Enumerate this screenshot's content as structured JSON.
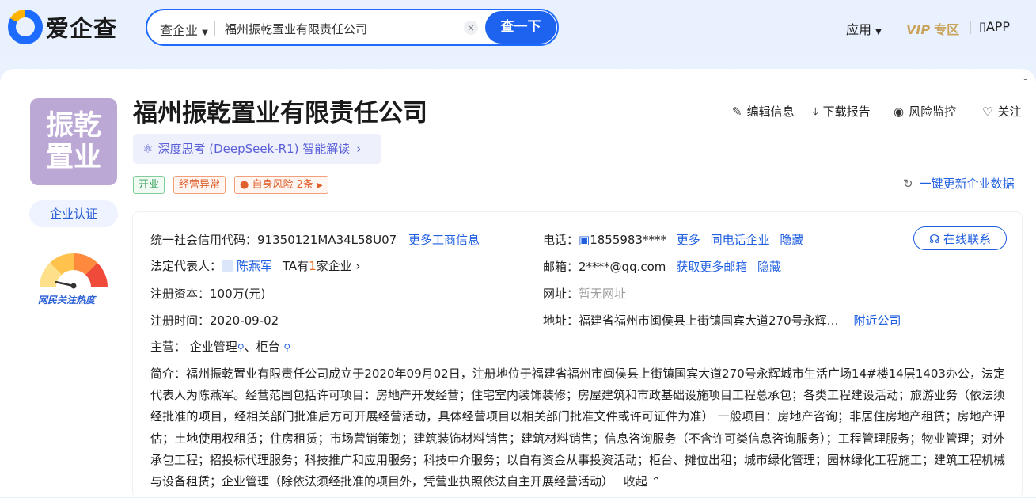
{
  "header": {
    "logo_text": "爱企查",
    "search_scope": "查企业",
    "search_value": "福州振乾置业有限责任公司",
    "search_button": "查一下",
    "nav_apps": "应用",
    "vip_prefix": "VIP",
    "vip_suffix": "专区",
    "app_label": "APP"
  },
  "company": {
    "logo_text_line1": "振乾",
    "logo_text_line2": "置业",
    "name": "福州振乾置业有限责任公司",
    "certification": "企业认证",
    "popularity_label": "网民关注热度",
    "deepseek": "深度思考 (DeepSeek-R1) 智能解读",
    "tags": {
      "status": "开业",
      "abnormal": "经营异常",
      "risk": "自身风险 2条"
    },
    "actions": {
      "edit": "编辑信息",
      "download": "下载报告",
      "monitor": "风险监控",
      "follow": "关注"
    },
    "update_data": "一键更新企业数据"
  },
  "info": {
    "credit_code_label": "统一社会信用代码：",
    "credit_code": "91350121MA34L58U07",
    "more_business": "更多工商信息",
    "legal_label": "法定代表人：",
    "legal_name": "陈燕军",
    "legal_extra_1": "TA有",
    "legal_count": "1",
    "legal_extra_2": "家企业",
    "capital_label": "注册资本：",
    "capital": "100万(元)",
    "reg_time_label": "注册时间：",
    "reg_time": "2020-09-02",
    "main_label": "主营：",
    "main_item1": "企业管理",
    "main_sep": "、",
    "main_item2": "柜台",
    "phone_label": "电话：",
    "phone": "1855983****",
    "phone_more": "更多",
    "phone_same": "同电话企业",
    "phone_hide": "隐藏",
    "email_label": "邮箱：",
    "email": "2****@qq.com",
    "email_more": "获取更多邮箱",
    "email_hide": "隐藏",
    "website_label": "网址：",
    "website": "暂无网址",
    "address_label": "地址：",
    "address": "福建省福州市闽侯县上街镇国宾大道270号永辉…",
    "nearby": "附近公司",
    "online_contact": "在线联系",
    "intro_label": "简介：",
    "intro": "福州振乾置业有限责任公司成立于2020年09月02日，注册地位于福建省福州市闽侯县上街镇国宾大道270号永辉城市生活广场14#楼14层1403办公，法定代表人为陈燕军。经营范围包括许可项目：房地产开发经营；住宅室内装饰装修；房屋建筑和市政基础设施项目工程总承包；各类工程建设活动；旅游业务（依法须经批准的项目，经相关部门批准后方可开展经营活动，具体经营项目以相关部门批准文件或许可证件为准） 一般项目：房地产咨询；非居住房地产租赁；房地产评估；土地使用权租赁；住房租赁；市场营销策划；建筑装饰材料销售；建筑材料销售；信息咨询服务（不含许可类信息咨询服务）；工程管理服务；物业管理；对外承包工程；招投标代理服务；科技推广和应用服务；科技中介服务；以自有资金从事投资活动；柜台、摊位出租；城市绿化管理；园林绿化工程施工；建筑工程机械与设备租赁；企业管理（除依法须经批准的项目外，凭营业执照依法自主开展经营活动）",
    "collapse": "收起"
  }
}
